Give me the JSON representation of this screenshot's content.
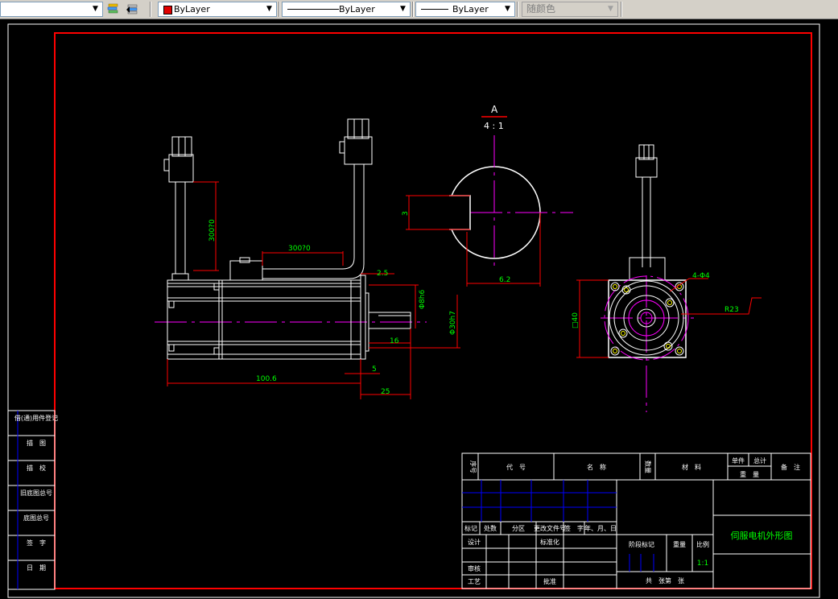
{
  "toolbar": {
    "color_value": "ByLayer",
    "linetype_value": "ByLayer",
    "lineweight_value": "ByLayer",
    "plotstyle_value": "随颜色"
  },
  "drawing": {
    "view_label": "A",
    "view_scale": "4 : 1",
    "dims": {
      "cable_len_left": "300?0",
      "cable_len_top": "300?0",
      "d_2_5": "2.5",
      "phi_8": "Φ8h6",
      "phi_30": "Φ30h7",
      "d_16": "16",
      "d_100_6": "100.6",
      "d_5": "5",
      "d_25": "25",
      "d_3": "3",
      "d_6_2": "6.2",
      "holes": "4-Φ4",
      "r23": "R23",
      "sq40": "□40"
    }
  },
  "left_table": {
    "rows": [
      "借(通)用件登记",
      "描　图",
      "描　校",
      "旧底图总号",
      "底图总号",
      "签　字",
      "日　期"
    ]
  },
  "title_block": {
    "header": [
      "序号",
      "代　号",
      "名　称",
      "数量",
      "材　料",
      "单件",
      "总计",
      "重　量",
      "备　注"
    ],
    "rev_row": [
      "标记",
      "处数",
      "分区",
      "更改文件号",
      "签　字",
      "年、月、日"
    ],
    "design": "设计",
    "standardization": "标准化",
    "stage_mark": "阶段标记",
    "weight": "重量",
    "scale": "比例",
    "scale_value": "1:1",
    "review": "审核",
    "process": "工艺",
    "approve": "批准",
    "sheets": "共　张第　张",
    "title": "伺服电机外形图"
  },
  "colors": {
    "frame": "#ff0000",
    "outline": "#ffffff",
    "center": "#ff00ff",
    "dimension": "#00ff00",
    "table": "#0000ff"
  }
}
